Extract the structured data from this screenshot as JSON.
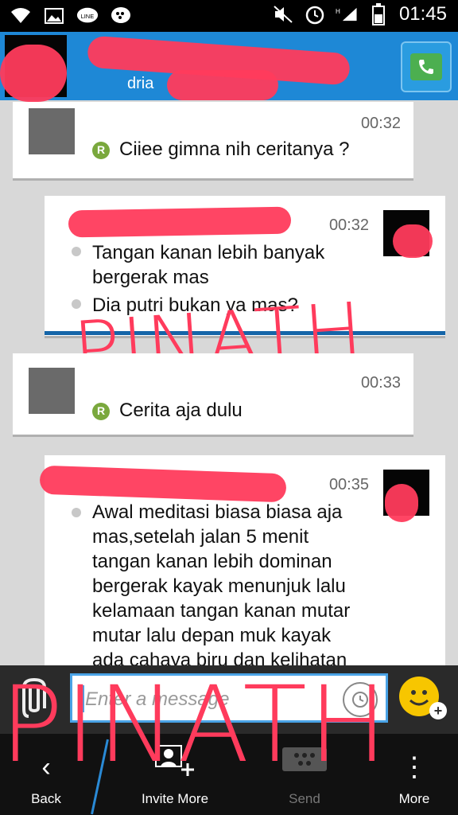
{
  "status_bar": {
    "time": "01:45",
    "icons": [
      "wifi-icon",
      "image-icon",
      "line-icon",
      "bbm-icon",
      "mute-icon",
      "alarm-icon",
      "signal-icon",
      "battery-icon"
    ]
  },
  "header": {
    "contact_name": "",
    "subtitle": "dria",
    "call_icon": "phone-icon"
  },
  "messages": [
    {
      "time": "00:32",
      "text": "Ciiee gimna nih ceritanya ?"
    },
    {
      "time": "00:32",
      "lines": [
        "Tangan kanan lebih banyak",
        "bergerak mas"
      ],
      "line2": "Dia putri bukan ya mas?"
    },
    {
      "time": "00:33",
      "text": "Cerita aja dulu"
    },
    {
      "time": "00:35",
      "lines": [
        "Awal meditasi biasa biasa aja",
        "mas,setelah jalan 5 menit",
        "tangan kanan lebih dominan",
        "bergerak kayak menunjuk lalu",
        "kelamaan tangan kanan mutar",
        "mutar lalu depan muk kayak",
        "ada cahaya biru dan kelihatan"
      ]
    }
  ],
  "input": {
    "placeholder": "Enter a message"
  },
  "bottom_bar": {
    "back": "Back",
    "invite": "Invite More",
    "send": "Send",
    "more": "More"
  },
  "overlay": {
    "scribble_top": "PINATH",
    "scribble_bottom": "PINATH"
  },
  "colors": {
    "header": "#1e88d6",
    "accent": "#ff3b5c",
    "badge": "#7aa83d"
  }
}
